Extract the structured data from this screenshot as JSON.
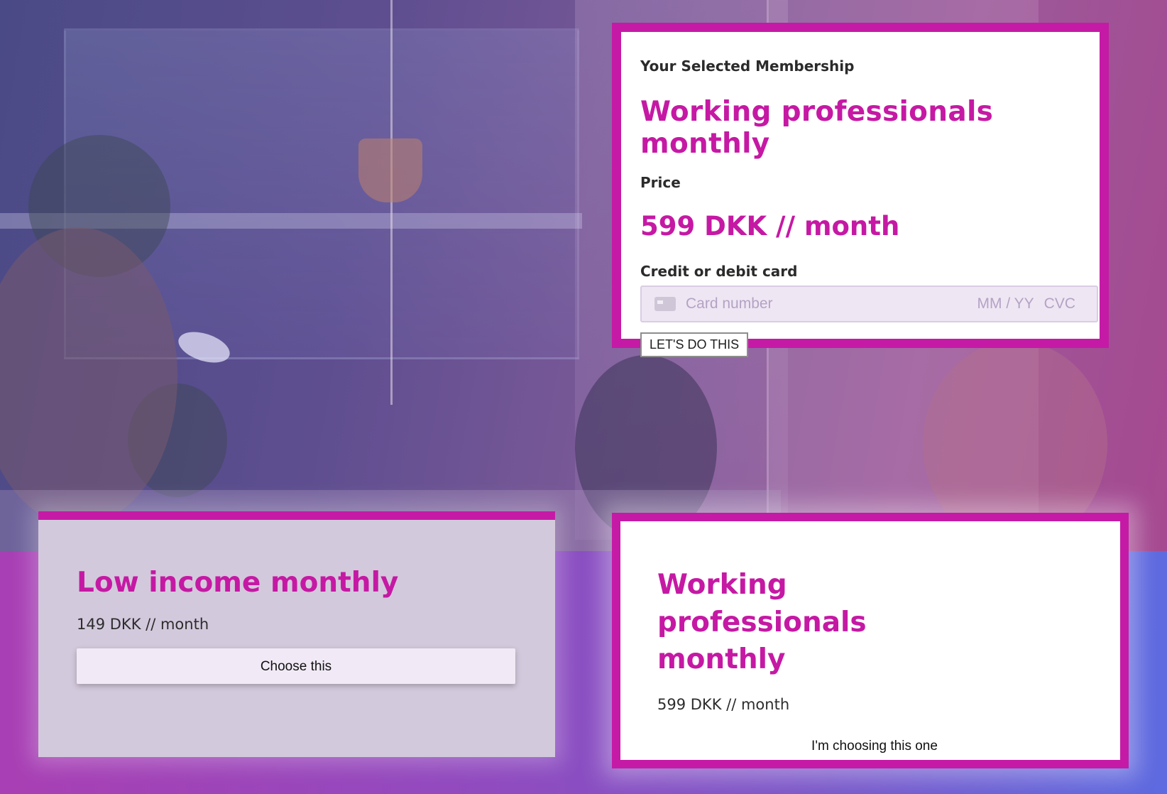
{
  "selected": {
    "heading": "Your Selected Membership",
    "plan_name": "Working professionals monthly",
    "price_label": "Price",
    "price": "599 DKK // month",
    "card_label": "Credit or debit card",
    "card_placeholder": "Card number",
    "expiry_placeholder": "MM / YY",
    "cvc_placeholder": "CVC",
    "submit_label": "LET'S DO THIS"
  },
  "plans": [
    {
      "name": "Low income monthly",
      "price": "149 DKK // month",
      "button_label": "Choose this"
    },
    {
      "name": "Working professionals monthly",
      "price": "599 DKK // month",
      "button_label": "I'm choosing this one"
    }
  ],
  "colors": {
    "accent": "#c519a4",
    "card_bg": "#ffffff",
    "inactive_card_bg": "#d3c9dc",
    "input_bg": "#efe6f4"
  },
  "icons": [
    "credit-card-icon"
  ]
}
